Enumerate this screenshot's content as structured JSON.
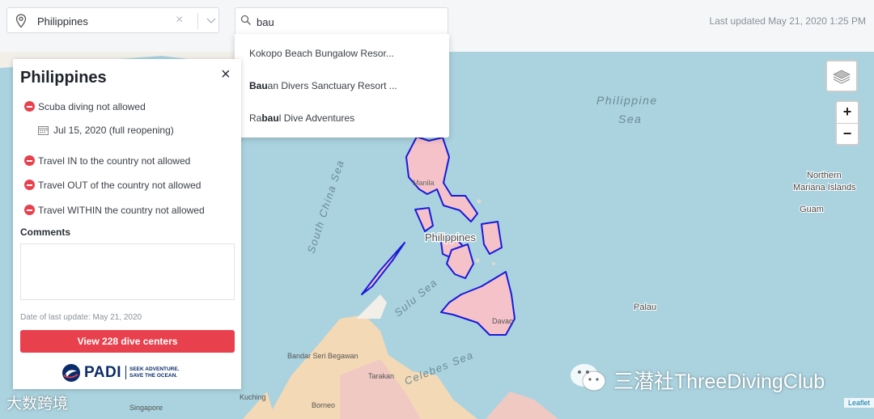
{
  "topbar": {
    "country_value": "Philippines",
    "search_value": "bau",
    "last_updated": "Last updated May 21, 2020 1:25 PM"
  },
  "dropdown": {
    "items": [
      {
        "pre": "Kokopo Beach Bungalow Resor...",
        "match": "",
        "post": ""
      },
      {
        "pre": "",
        "match": "Bau",
        "post": "an Divers Sanctuary Resort ..."
      },
      {
        "pre": "Ra",
        "match": "bau",
        "post": "l Dive Adventures"
      }
    ]
  },
  "panel": {
    "title": "Philippines",
    "close": "×",
    "scuba": "Scuba diving not allowed",
    "reopen_date": "Jul 15, 2020 (full reopening)",
    "travel_in": "Travel IN to the country not allowed",
    "travel_out": "Travel OUT of the country not allowed",
    "travel_within": "Travel WITHIN the country not allowed",
    "comments_label": "Comments",
    "date_of_update": "Date of last update: May 21, 2020",
    "view_button": "View 228 dive centers",
    "brand_name": "PADI",
    "brand_tagline_1": "SEEK ADVENTURE.",
    "brand_tagline_2": "SAVE THE OCEAN."
  },
  "map": {
    "labels": {
      "philippine_sea_1": "Philippine",
      "philippine_sea_2": "Sea",
      "south_china_sea": "South China Sea",
      "sulu_sea": "Sulu Sea",
      "celebes_sea": "Celebes Sea",
      "philippines": "Philippines",
      "manila": "Manila",
      "tarakan": "Tarakan",
      "bandar": "Bandar Seri Begawan",
      "kuching": "Kuching",
      "singapore": "Singapore",
      "borneo": "Borneo",
      "palau": "Palau",
      "guam": "Guam",
      "northern_mariana_1": "Northern",
      "northern_mariana_2": "Mariana Islands",
      "davao": "Davao"
    },
    "zoom_in": "+",
    "zoom_out": "−",
    "attribution": "Leaflet",
    "colors": {
      "water": "#aad3df",
      "land": "#f2efe9",
      "highlight_fill": "#f4c2c8",
      "highlight_stroke": "#1a1adb",
      "neighbor_fill": "#f3d9b5",
      "neighbor_fill_2": "#f0c9c3"
    }
  },
  "watermarks": {
    "main": "三潜社ThreeDivingClub",
    "corner": "大数跨境"
  },
  "colors": {
    "accent_red": "#e8414d",
    "padi_blue": "#0b2c6b"
  }
}
